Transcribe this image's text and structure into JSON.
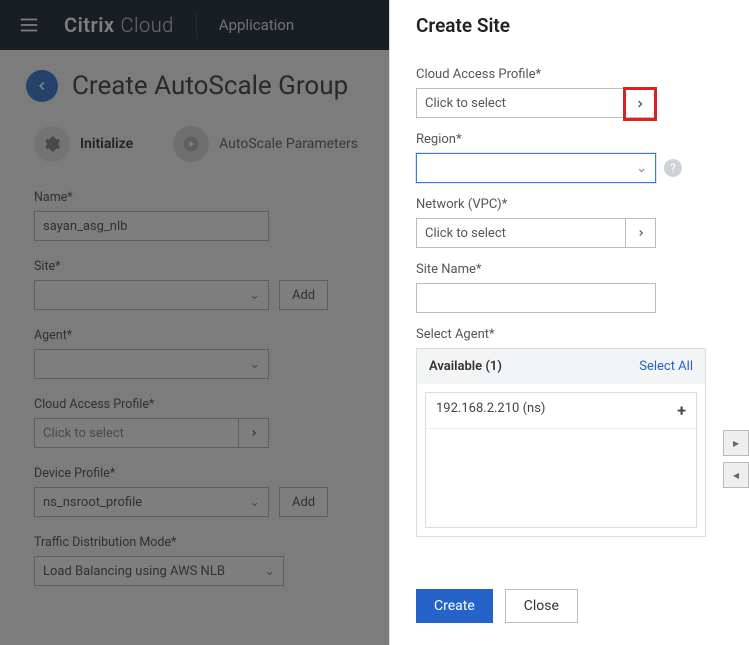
{
  "header": {
    "brand_bold": "Citrix",
    "brand_light": "Cloud",
    "nav_item": "Application"
  },
  "page": {
    "title": "Create AutoScale Group",
    "steps": {
      "initialize": "Initialize",
      "autoscale": "AutoScale Parameters"
    },
    "fields": {
      "name": {
        "label": "Name*",
        "value": "sayan_asg_nlb"
      },
      "site": {
        "label": "Site*",
        "add": "Add"
      },
      "agent": {
        "label": "Agent*"
      },
      "cap": {
        "label": "Cloud Access Profile*",
        "value": "Click to select"
      },
      "device": {
        "label": "Device Profile*",
        "value": "ns_nsroot_profile",
        "add": "Add"
      },
      "traffic": {
        "label": "Traffic Distribution Mode*",
        "value": "Load Balancing using AWS NLB"
      }
    }
  },
  "panel": {
    "title": "Create Site",
    "cap": {
      "label": "Cloud Access Profile*",
      "value": "Click to select"
    },
    "region": {
      "label": "Region*"
    },
    "network": {
      "label": "Network (VPC)*",
      "value": "Click to select"
    },
    "sitename": {
      "label": "Site Name*"
    },
    "selectagent": {
      "label": "Select Agent*",
      "available": "Available (1)",
      "selectall": "Select All",
      "items": [
        "192.168.2.210 (ns)"
      ]
    },
    "create": "Create",
    "close": "Close"
  }
}
